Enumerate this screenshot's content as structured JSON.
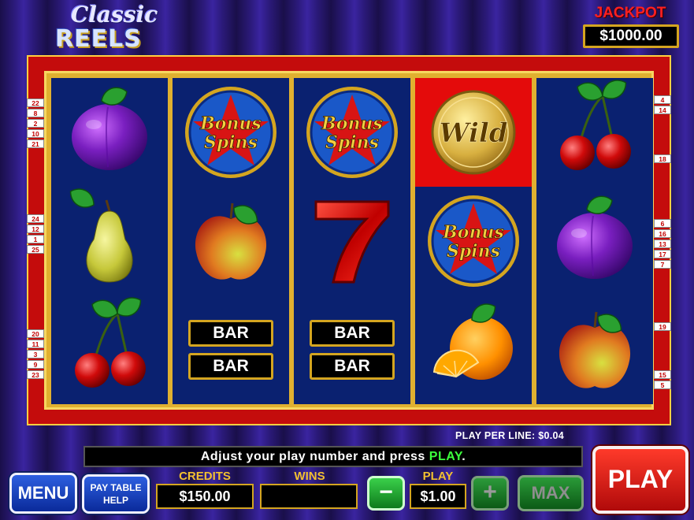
{
  "logo": {
    "line1": "Classic",
    "line2": "REELS"
  },
  "jackpot": {
    "label": "JACKPOT",
    "value": "$1000.00"
  },
  "reels": [
    [
      "plum",
      "pear",
      "cherry"
    ],
    [
      "bonus-spins",
      "apple",
      "double-bar"
    ],
    [
      "bonus-spins",
      "seven",
      "double-bar"
    ],
    [
      "wild",
      "bonus-spins",
      "orange"
    ],
    [
      "cherry",
      "plum",
      "apple"
    ]
  ],
  "symbol_text": {
    "bonus_1": "Bonus",
    "bonus_2": "Spins",
    "wild": "Wild",
    "bar": "BAR",
    "seven": "7"
  },
  "highlighted_cell": {
    "reel": 4,
    "row": 1
  },
  "line_markers": {
    "left": [
      "22",
      "8",
      "2",
      "10",
      "21",
      "24",
      "12",
      "1",
      "25",
      "20",
      "11",
      "3",
      "9",
      "23"
    ],
    "right": [
      "4",
      "14",
      "18",
      "6",
      "16",
      "13",
      "17",
      "7",
      "19",
      "15",
      "5"
    ]
  },
  "play_per_line": "PLAY PER LINE: $0.04",
  "message": {
    "prefix": "Adjust your play number and press ",
    "highlight": "PLAY",
    "suffix": "."
  },
  "buttons": {
    "menu": "MENU",
    "paytable_line1": "PAY TABLE",
    "paytable_line2": "HELP",
    "minus": "−",
    "plus": "+",
    "max": "MAX",
    "play": "PLAY"
  },
  "credits": {
    "label": "CREDITS",
    "value": "$150.00"
  },
  "wins": {
    "label": "WINS",
    "value": ""
  },
  "play": {
    "label": "PLAY",
    "value": "$1.00"
  },
  "colors": {
    "reel_bg": "#0a2170",
    "frame": "#c40c0c",
    "gold": "#d4a520",
    "highlight": "#e40b0b"
  }
}
